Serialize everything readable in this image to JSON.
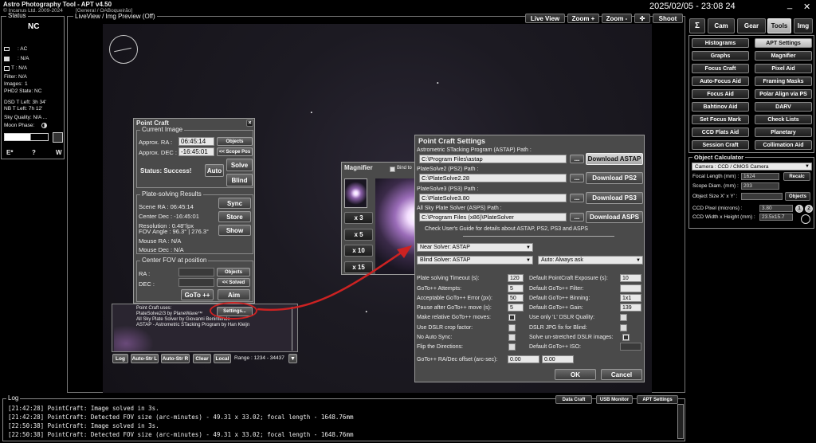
{
  "app": {
    "title": "Astro Photography Tool - APT v4.50",
    "copyright": "© Incanus Ltd. 2009-2024",
    "profile": "[General / OABoqueirão]",
    "datetime": "2025/02/05 - 23:08 24",
    "minimize": "_",
    "close": "✕"
  },
  "status": {
    "title": "Status",
    "nc": "NC",
    "ac": ": AC",
    "na1": ": N/A",
    "na2": "T : N/A",
    "filter": "Filter: N/A",
    "images_label": "Images:",
    "images": "1",
    "phd2_label": "PHD2 State:",
    "phd2": "NC",
    "dsd": "DSD T Left: 3h 34'",
    "nb": "NB T Left: 7h 12'",
    "sky": "Sky Quality: N/A ...",
    "moon": "Moon Phase:",
    "compass": [
      "E*",
      "?",
      "W"
    ]
  },
  "liveview": {
    "title": "LiveView / Img Preview (Off)",
    "buttons": [
      "Live View",
      "Zoom +",
      "Zoom -",
      "Shoot"
    ]
  },
  "tabs": [
    "Σ",
    "Cam",
    "Gear",
    "Tools",
    "Img"
  ],
  "tools": [
    [
      "Histograms",
      "APT Settings"
    ],
    [
      "Graphs",
      "Magnifier"
    ],
    [
      "Focus Craft",
      "Pixel Aid"
    ],
    [
      "Auto-Focus Aid",
      "Framing Masks"
    ],
    [
      "Focus Aid",
      "Polar Align via PS"
    ],
    [
      "Bahtinov Aid",
      "DARV"
    ],
    [
      "Set Focus Mark",
      "Check Lists"
    ],
    [
      "CCD Flats Aid",
      "Planetary"
    ],
    [
      "Session Craft",
      "Collimation Aid"
    ]
  ],
  "objcalc": {
    "title": "Object Calculator",
    "camera": "Camera : CCD / CMOS Camera",
    "focal_label": "Focal Length (mm) :",
    "focal": "1624",
    "recalc": "Recalc",
    "scope_label": "Scope Diam. (mm) :",
    "scope": "203",
    "size_label": "Object Size X' x Y' :",
    "objects": "Objects",
    "pixel_label": "CCD Pixel (microns) :",
    "pixel": "3.80",
    "wh_label": "CCD Width x Height (mm) :",
    "wh": "23.5x15.7"
  },
  "pointcraft": {
    "title": "Point Craft",
    "current_image": "Current Image",
    "ra_label": "Approx. RA :",
    "ra": "06:45:14",
    "dec_label": "Approx. DEC :",
    "dec": "-16:45:01",
    "objects": "Objects",
    "scope_pos": "<< Scope Pos",
    "status": "Status: Success!",
    "auto": "Auto",
    "solve": "Solve",
    "blind": "Blind",
    "results_title": "Plate-solving Results",
    "scene_ra": "Scene RA :    06:45:14",
    "center_dec": "Center Dec :  -16:45:01",
    "resolution": "Resolution :  0.48\"/px",
    "fov": "FOV Angle :  96.3° | 276.3°",
    "mouse_ra": "Mouse RA :     N/A",
    "mouse_dec": "Mouse Dec :    N/A",
    "sync": "Sync",
    "store": "Store",
    "show": "Show",
    "center_title": "Center FOV at position",
    "ra2": "RA :",
    "dec2": "DEC :",
    "objects2": "Objects",
    "solved": "<< Solved",
    "goto": "GoTo ++",
    "aim": "Aim",
    "uses1": "Point Craft uses:",
    "uses2": "PlateSolve2/3 by PlaneWave™",
    "uses3": "All Sky Plate Solver by Giovanni Benintende",
    "uses4": "ASTAP - Astrometric STacking Program by Han Kleijn",
    "settings": "Settings..."
  },
  "bottombar": {
    "log": "Log",
    "autostrl": "Auto-Str L",
    "autostrr": "Auto-Str R",
    "clear": "Clear",
    "local": "Local",
    "range": "Range : 1234 - 34437"
  },
  "magnifier": {
    "title": "Magnifier",
    "bind": "Bind to",
    "zooms": [
      "x 3",
      "x 5",
      "x 10",
      "x 15"
    ]
  },
  "pcs": {
    "title": "Point Craft Settings",
    "astap_label": "Astrometric STacking Program (ASTAP) Path :",
    "astap": "C:\\Program Files\\astap",
    "ps2_label": "PlateSolve2 (PS2) Path :",
    "ps2": "C:\\PlateSolve2.28",
    "ps3_label": "PlateSolve3 (PS3) Path :",
    "ps3": "C:\\PlateSolve3.80",
    "asps_label": "All Sky Plate Solver (ASPS) Path :",
    "asps": "C:\\Program Files (x86)\\PlateSolver",
    "dots": "...",
    "dl_astap": "Download ASTAP",
    "dl_ps2": "Download PS2",
    "dl_ps3": "Download PS3",
    "dl_asps": "Download ASPS",
    "guide": "Check User's Guide for details about ASTAP, PS2, PS3 and ASPS",
    "near": "Near Solver: ASTAP",
    "blind": "Blind Solver: ASTAP",
    "always": "Auto: Always ask",
    "left_rows": [
      [
        "Plate solving Timeout (s):",
        "120"
      ],
      [
        "GoTo++ Attempts:",
        "5"
      ],
      [
        "Acceptable GoTo++ Error (px):",
        "50"
      ],
      [
        "Pause after GoTo++ move (s):",
        "5"
      ]
    ],
    "left_checks": [
      "Make relative GoTo++ moves:",
      "Use DSLR crop factor:",
      "No Auto Sync:",
      "Flip the Directions:"
    ],
    "right_rows": [
      [
        "Default PointCraft Exposure (s):",
        "10"
      ],
      [
        "Default GoTo++ Filter:",
        ""
      ],
      [
        "Default GoTo++ Binning:",
        "1x1"
      ],
      [
        "Default GoTo++ Gain:",
        "139"
      ]
    ],
    "right_checks": [
      "Use only 'L' DSLR Quality:",
      "DSLR JPG fix for Blind:",
      "Solve un-stretched DSLR images:",
      "Default GoTo++ ISO:"
    ],
    "offset_label": "GoTo++ RA/Dec offset (arc-sec):",
    "offset_ra": "0.00",
    "offset_dec": "0.00",
    "ok": "OK",
    "cancel": "Cancel"
  },
  "log": {
    "title": "Log",
    "buttons": [
      "Data Craft",
      "USB Monitor",
      "APT Settings"
    ],
    "lines": [
      "[21:42:28] PointCraft: Image solved in 3s.",
      "[21:42:28] PointCraft: Detected FOV size (arc-minutes) - 49.31 x 33.02; focal length - 1648.76mm",
      "[22:50:38] PointCraft: Image solved in 3s.",
      "[22:50:38] PointCraft: Detected FOV size (arc-minutes) - 49.31 x 33.02; focal length - 1648.76mm"
    ]
  },
  "colors": {
    "accent": "#cc2222",
    "panel": "#4a4a4a"
  }
}
